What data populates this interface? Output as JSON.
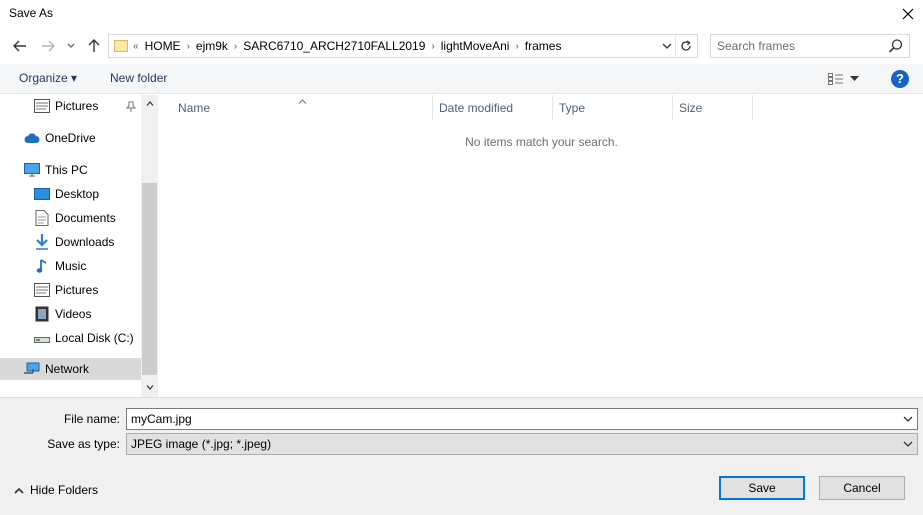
{
  "window": {
    "title": "Save As"
  },
  "address": {
    "crumbs": [
      "HOME",
      "ejm9k",
      "SARC6710_ARCH2710FALL2019",
      "lightMoveAni",
      "frames"
    ]
  },
  "search": {
    "placeholder": "Search frames"
  },
  "toolbar": {
    "organize": "Organize ▾",
    "new_folder": "New folder",
    "help": "?"
  },
  "nav": {
    "items": [
      {
        "label": "Pictures",
        "icon": "pictures-icon"
      },
      {
        "label": "OneDrive",
        "icon": "onedrive-icon"
      },
      {
        "label": "This PC",
        "icon": "this-pc-icon"
      },
      {
        "label": "Desktop",
        "icon": "desktop-icon"
      },
      {
        "label": "Documents",
        "icon": "documents-icon"
      },
      {
        "label": "Downloads",
        "icon": "downloads-icon"
      },
      {
        "label": "Music",
        "icon": "music-icon"
      },
      {
        "label": "Pictures",
        "icon": "pictures-icon"
      },
      {
        "label": "Videos",
        "icon": "videos-icon"
      },
      {
        "label": "Local Disk (C:)",
        "icon": "local-disk-icon"
      },
      {
        "label": "Network",
        "icon": "network-icon"
      }
    ]
  },
  "columns": [
    "Name",
    "Date modified",
    "Type",
    "Size"
  ],
  "empty_message": "No items match your search.",
  "form": {
    "file_name_label": "File name:",
    "file_name_value": "myCam.jpg",
    "save_type_label": "Save as type:",
    "save_type_value": "JPEG image (*.jpg; *.jpeg)"
  },
  "footer": {
    "hide_folders": "Hide Folders",
    "save": "Save",
    "cancel": "Cancel"
  },
  "colors": {
    "accent": "#0078d7",
    "selected": "#d9d9d9",
    "help_blue": "#1565c0"
  }
}
